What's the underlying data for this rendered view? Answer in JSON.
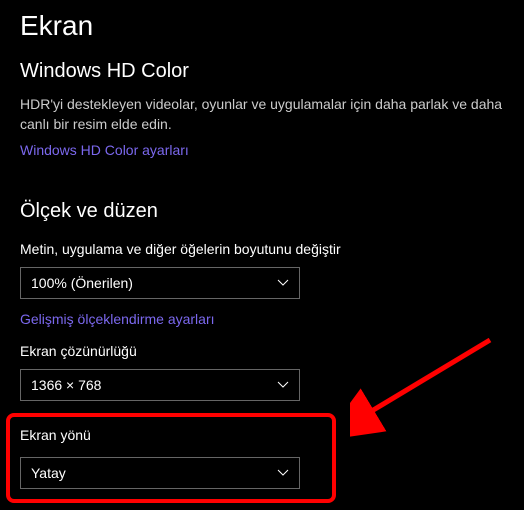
{
  "page": {
    "title": "Ekran"
  },
  "hd_color": {
    "title": "Windows HD Color",
    "description": "HDR'yi destekleyen videolar, oyunlar ve uygulamalar için daha parlak ve daha canlı bir resim elde edin.",
    "link": "Windows HD Color ayarları"
  },
  "scale_layout": {
    "title": "Ölçek ve düzen",
    "text_size": {
      "label": "Metin, uygulama ve diğer öğelerin boyutunu değiştir",
      "value": "100% (Önerilen)"
    },
    "advanced_link": "Gelişmiş ölçeklendirme ayarları",
    "resolution": {
      "label": "Ekran çözünürlüğü",
      "value": "1366 × 768"
    },
    "orientation": {
      "label": "Ekran yönü",
      "value": "Yatay"
    }
  }
}
